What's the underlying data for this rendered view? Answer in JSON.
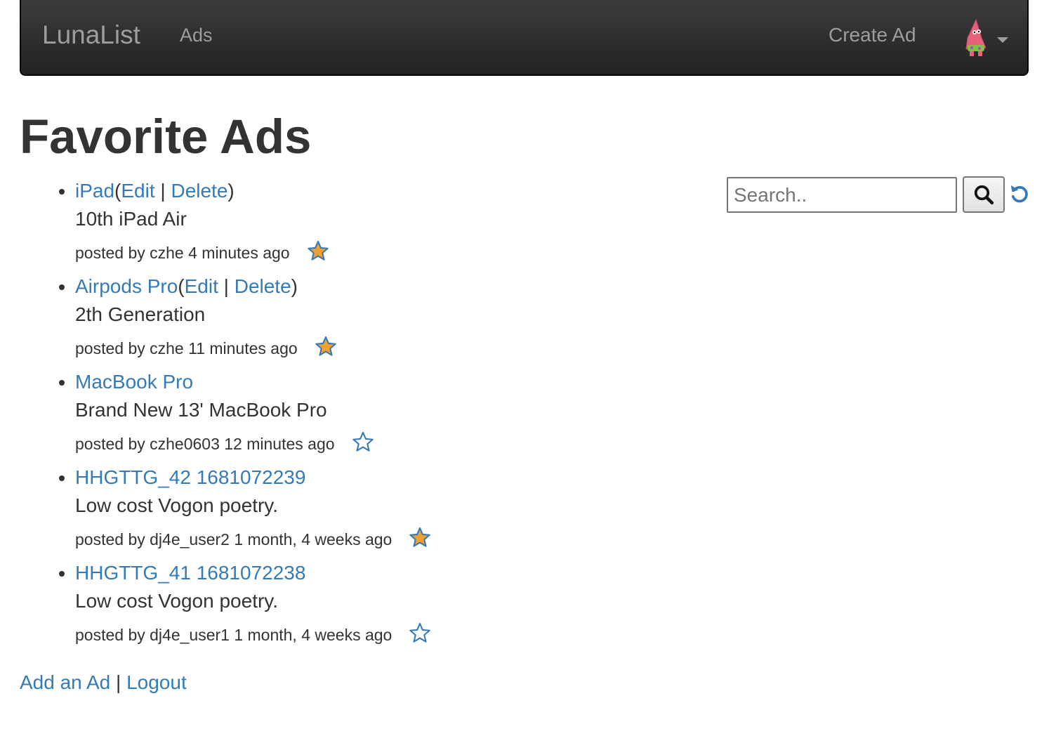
{
  "navbar": {
    "brand": "LunaList",
    "ads_link": "Ads",
    "create_ad": "Create Ad",
    "avatar_icon": "patrick-star-avatar",
    "caret_icon": "caret-down-icon"
  },
  "page_title": "Favorite Ads",
  "ads": [
    {
      "title": "iPad",
      "edit": "Edit",
      "delete": "Delete",
      "description": "10th iPad Air",
      "posted": "posted by czhe 4 minutes ago",
      "favorited": true
    },
    {
      "title": "Airpods Pro",
      "edit": "Edit",
      "delete": "Delete",
      "description": "2th Generation",
      "posted": "posted by czhe 11 minutes ago",
      "favorited": true
    },
    {
      "title": "MacBook Pro",
      "description": "Brand New 13' MacBook Pro",
      "posted": "posted by czhe0603 12 minutes ago",
      "favorited": false
    },
    {
      "title": "HHGTTG_42 1681072239",
      "description": "Low cost Vogon poetry.",
      "posted": "posted by dj4e_user2 1 month, 4 weeks ago",
      "favorited": true
    },
    {
      "title": "HHGTTG_41 1681072238",
      "description": "Low cost Vogon poetry.",
      "posted": "posted by dj4e_user1 1 month, 4 weeks ago",
      "favorited": false
    }
  ],
  "search": {
    "placeholder": "Search..",
    "value": "",
    "button_icon": "search-icon",
    "reset_icon": "undo-icon"
  },
  "footer": {
    "add_ad": "Add an Ad",
    "separator": "|",
    "logout": "Logout"
  },
  "colors": {
    "link": "#337ab7",
    "star_fill": "#f0a030",
    "star_outline": "#337ab7",
    "navbar": "#222222"
  }
}
